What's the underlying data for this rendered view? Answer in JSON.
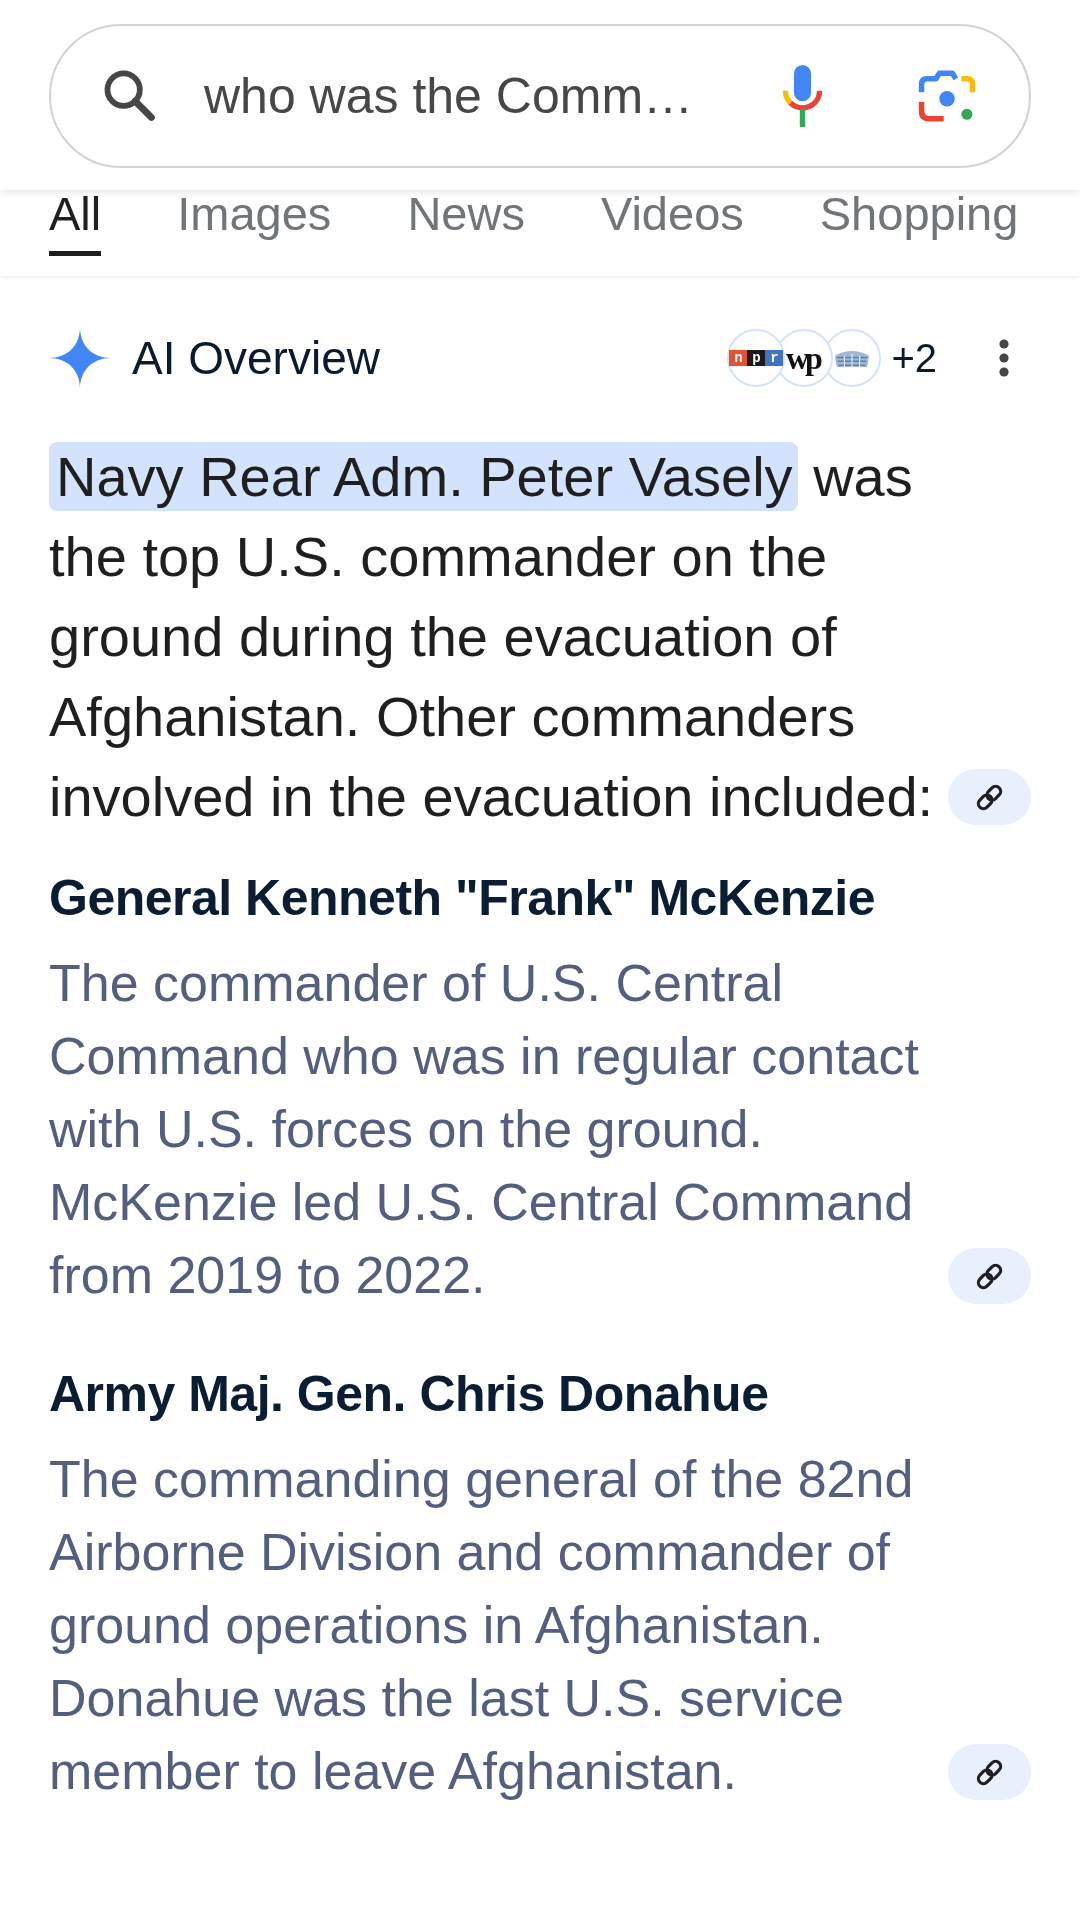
{
  "search_bar": {
    "value": "who was the Comm…"
  },
  "tabs": [
    {
      "label": "All",
      "selected": true
    },
    {
      "label": "Images",
      "selected": false
    },
    {
      "label": "News",
      "selected": false
    },
    {
      "label": "Videos",
      "selected": false
    },
    {
      "label": "Shopping",
      "selected": false
    }
  ],
  "ai_overview": {
    "title": "AI Overview",
    "sources": {
      "logos": [
        {
          "kind": "tiles",
          "text": "npr"
        },
        {
          "kind": "blackletter",
          "text": "wp"
        },
        {
          "kind": "picture"
        }
      ],
      "more": "+2"
    },
    "summary": {
      "highlight": "Navy Rear Adm. Peter Vasely",
      "text": "was the top U.S. commander on the ground during the evacuation of Afghanistan. Other commanders involved in the evacuation included:"
    },
    "sections": [
      {
        "heading": "General Kenneth \"Frank\" McKenzie",
        "text": "The commander of U.S. Central Command who was in regular contact with U.S. forces on the ground. McKenzie led U.S. Central Command from 2019 to 2022."
      },
      {
        "heading": "Army Maj. Gen. Chris Donahue",
        "text": "The commanding general of the 82nd Airborne Division and commander of ground operations in Afghanistan. Donahue was the last U.S. service member to leave Afghanistan."
      }
    ]
  }
}
